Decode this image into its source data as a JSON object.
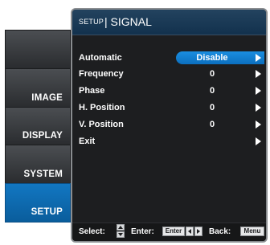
{
  "sidebar": {
    "items": [
      {
        "label": "",
        "active": false
      },
      {
        "label": "IMAGE",
        "active": false
      },
      {
        "label": "DISPLAY",
        "active": false
      },
      {
        "label": "SYSTEM",
        "active": false
      },
      {
        "label": "SETUP",
        "active": true
      }
    ]
  },
  "header": {
    "section": "SETUP",
    "separator": "|",
    "title": "SIGNAL"
  },
  "settings": {
    "rows": [
      {
        "name": "Automatic",
        "value": "Disable",
        "selected": true
      },
      {
        "name": "Frequency",
        "value": "0",
        "selected": false
      },
      {
        "name": "Phase",
        "value": "0",
        "selected": false
      },
      {
        "name": "H. Position",
        "value": "0",
        "selected": false
      },
      {
        "name": "V. Position",
        "value": "0",
        "selected": false
      },
      {
        "name": "Exit",
        "value": "",
        "selected": false
      }
    ]
  },
  "footer": {
    "select_label": "Select:",
    "enter_label": "Enter:",
    "enter_key": "Enter",
    "back_label": "Back:",
    "back_key": "Menu"
  },
  "colors": {
    "accent": "#1279c6",
    "panel_bg": "#1d1e20",
    "title_bg": "#17385a"
  },
  "icons": {
    "row_arrow": "right-arrow-icon",
    "select_keys": "up-down-arrows-icon",
    "enter_left": "left-arrow-key-icon",
    "enter_right": "right-arrow-key-icon"
  }
}
